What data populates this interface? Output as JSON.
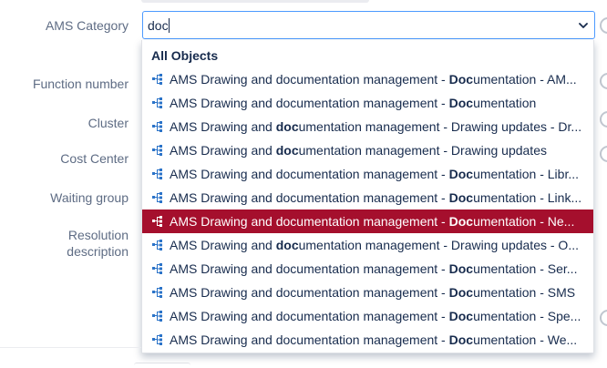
{
  "form": {
    "labels": {
      "ams_category": "AMS Category",
      "function_number": "Function number",
      "cluster": "Cluster",
      "cost_center": "Cost Center",
      "waiting_group": "Waiting group",
      "resolution_line1": "Resolution",
      "resolution_line2": "description"
    }
  },
  "select": {
    "value": "doc",
    "chevron_icon": "chevron-down-icon"
  },
  "dropdown": {
    "group_header": "All Objects",
    "option_icon": "hierarchy-object-icon",
    "selected_index": 6,
    "options": [
      {
        "pre": "AMS Drawing and documentation management - ",
        "match": "Doc",
        "post": "umentation - AM..."
      },
      {
        "pre": "AMS Drawing and documentation management - ",
        "match": "Doc",
        "post": "umentation"
      },
      {
        "pre": "AMS Drawing and ",
        "match": "doc",
        "post": "umentation management - Drawing updates - Dr..."
      },
      {
        "pre": "AMS Drawing and ",
        "match": "doc",
        "post": "umentation management - Drawing updates"
      },
      {
        "pre": "AMS Drawing and documentation management - ",
        "match": "Doc",
        "post": "umentation - Libr..."
      },
      {
        "pre": "AMS Drawing and documentation management - ",
        "match": "Doc",
        "post": "umentation - Link..."
      },
      {
        "pre": "AMS Drawing and documentation management - ",
        "match": "Doc",
        "post": "umentation - Ne..."
      },
      {
        "pre": "AMS Drawing and ",
        "match": "doc",
        "post": "umentation management - Drawing updates - O..."
      },
      {
        "pre": "AMS Drawing and documentation management - ",
        "match": "Doc",
        "post": "umentation - Ser..."
      },
      {
        "pre": "AMS Drawing and documentation management - ",
        "match": "Doc",
        "post": "umentation - SMS"
      },
      {
        "pre": "AMS Drawing and documentation management - ",
        "match": "Doc",
        "post": "umentation - Spe..."
      },
      {
        "pre": "AMS Drawing and documentation management - ",
        "match": "Doc",
        "post": "umentation - We..."
      }
    ]
  },
  "colors": {
    "selected_bg": "#a50f2d",
    "focus_border": "#4c9aff",
    "icon_blue": "#2b73c8"
  }
}
